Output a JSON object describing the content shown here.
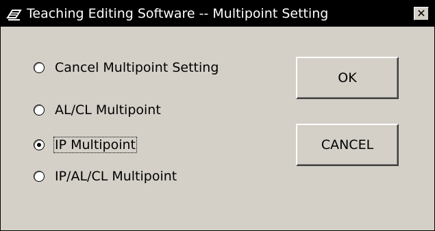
{
  "window": {
    "title": "Teaching Editing Software -- Multipoint Setting",
    "close_label": "✕"
  },
  "options": [
    {
      "label": "Cancel Multipoint Setting",
      "selected": false
    },
    {
      "label": "AL/CL Multipoint",
      "selected": false
    },
    {
      "label": "IP Multipoint",
      "selected": true
    },
    {
      "label": "IP/AL/CL Multipoint",
      "selected": false
    }
  ],
  "buttons": {
    "ok_label": "OK",
    "cancel_label": "CANCEL"
  }
}
